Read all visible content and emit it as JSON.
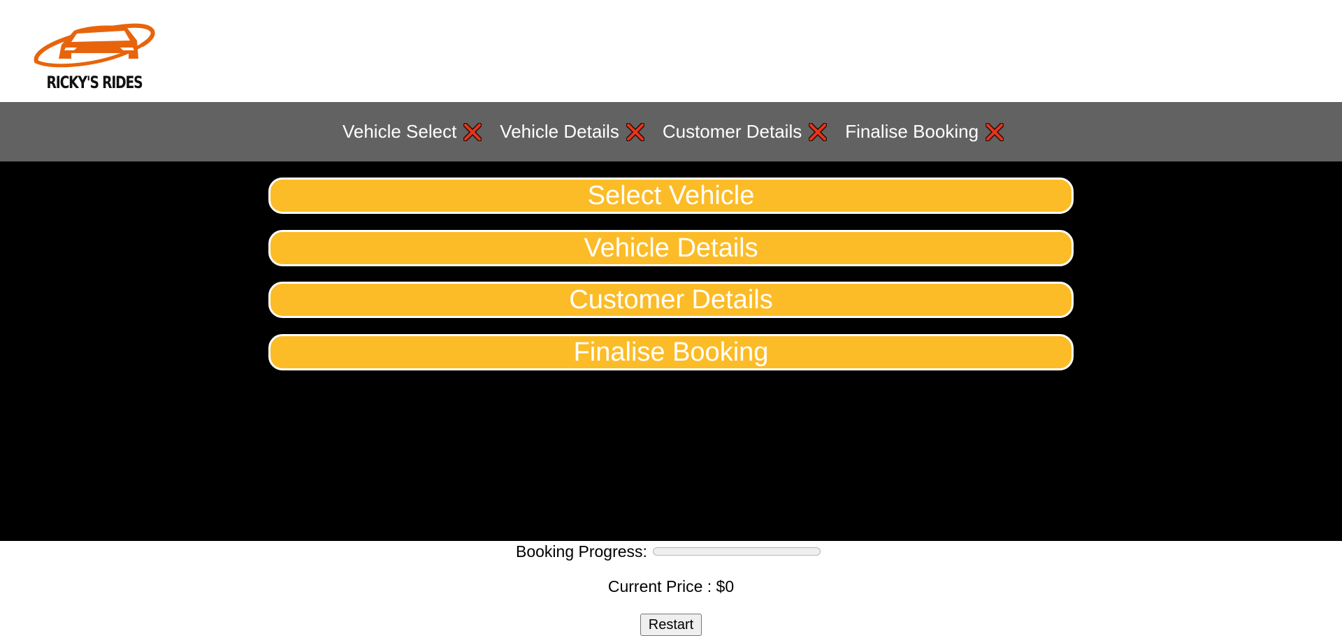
{
  "logo": {
    "icon": "car-with-orbit-logo",
    "text": "RICKY'S RIDES",
    "color": "#e8640c"
  },
  "steps": [
    {
      "label": "Vehicle Select",
      "status_icon": "x-icon",
      "complete": false
    },
    {
      "label": "Vehicle Details",
      "status_icon": "x-icon",
      "complete": false
    },
    {
      "label": "Customer Details",
      "status_icon": "x-icon",
      "complete": false
    },
    {
      "label": "Finalise Booking",
      "status_icon": "x-icon",
      "complete": false
    }
  ],
  "sections": [
    {
      "label": "Select Vehicle"
    },
    {
      "label": "Vehicle Details"
    },
    {
      "label": "Customer Details"
    },
    {
      "label": "Finalise Booking"
    }
  ],
  "footer": {
    "progress_label": "Booking Progress:",
    "progress_value": 0,
    "price_label": "Current Price : $0",
    "restart_label": "Restart"
  },
  "colors": {
    "accent": "#fcbc28",
    "step_bar": "#626262",
    "main_bg": "#000000",
    "x_icon": "#e8341c"
  }
}
